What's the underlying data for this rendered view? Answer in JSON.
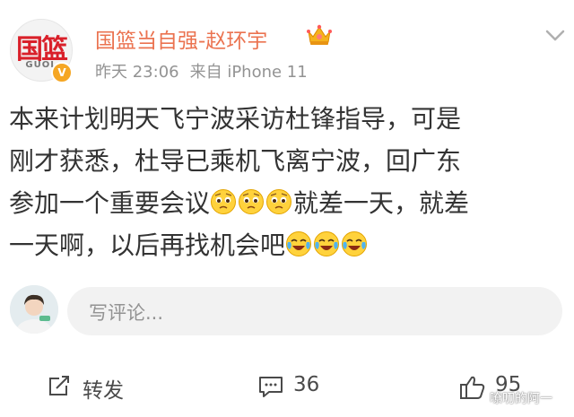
{
  "post": {
    "author": {
      "name": "国篮当自强-赵环宇",
      "avatar_text": "国篮",
      "avatar_subtext": "GUOL",
      "verified_badge": "V"
    },
    "meta": {
      "time": "昨天 23:06",
      "source": "来自 iPhone 11"
    },
    "text_lines": [
      "本来计划明天飞宁波采访杜锋指导，可是",
      "刚才获悉，杜导已乘机飞离宁波，回广东",
      "参加一个重要会议",
      "就差一天，就差",
      "一天啊，以后再找机会吧"
    ],
    "emojis": {
      "worried": "worried-emoji-icon",
      "laugh_cry": "laugh-cry-emoji-icon"
    }
  },
  "comment_box": {
    "placeholder": "写评论..."
  },
  "actions": {
    "repost_label": "转发",
    "comments_count": "36",
    "likes_count": "95"
  },
  "watermark": "嘹叨的阿一",
  "colors": {
    "username": "#eb7350",
    "meta": "#939393",
    "text": "#333333",
    "input_bg": "#f2f2f2"
  }
}
